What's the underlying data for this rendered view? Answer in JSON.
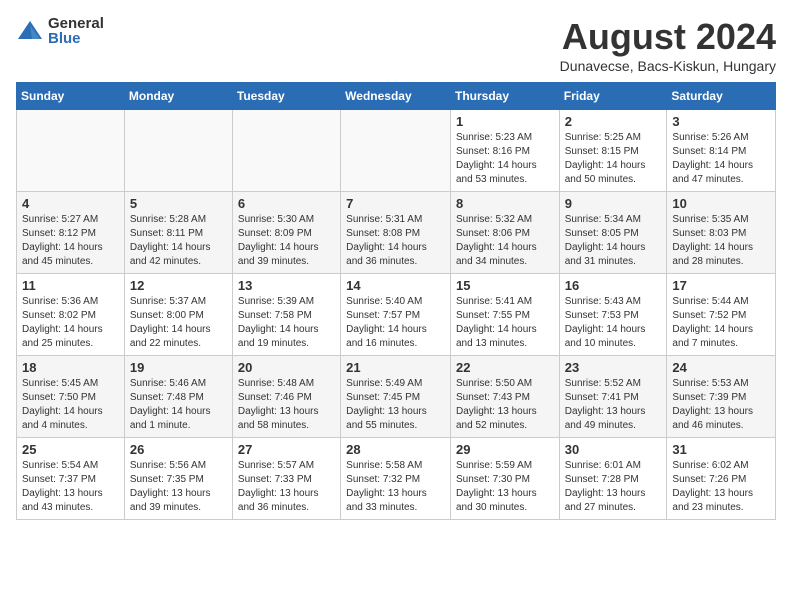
{
  "header": {
    "logo_general": "General",
    "logo_blue": "Blue",
    "title": "August 2024",
    "subtitle": "Dunavecse, Bacs-Kiskun, Hungary"
  },
  "weekdays": [
    "Sunday",
    "Monday",
    "Tuesday",
    "Wednesday",
    "Thursday",
    "Friday",
    "Saturday"
  ],
  "weeks": [
    [
      {
        "num": "",
        "info": ""
      },
      {
        "num": "",
        "info": ""
      },
      {
        "num": "",
        "info": ""
      },
      {
        "num": "",
        "info": ""
      },
      {
        "num": "1",
        "info": "Sunrise: 5:23 AM\nSunset: 8:16 PM\nDaylight: 14 hours and 53 minutes."
      },
      {
        "num": "2",
        "info": "Sunrise: 5:25 AM\nSunset: 8:15 PM\nDaylight: 14 hours and 50 minutes."
      },
      {
        "num": "3",
        "info": "Sunrise: 5:26 AM\nSunset: 8:14 PM\nDaylight: 14 hours and 47 minutes."
      }
    ],
    [
      {
        "num": "4",
        "info": "Sunrise: 5:27 AM\nSunset: 8:12 PM\nDaylight: 14 hours and 45 minutes."
      },
      {
        "num": "5",
        "info": "Sunrise: 5:28 AM\nSunset: 8:11 PM\nDaylight: 14 hours and 42 minutes."
      },
      {
        "num": "6",
        "info": "Sunrise: 5:30 AM\nSunset: 8:09 PM\nDaylight: 14 hours and 39 minutes."
      },
      {
        "num": "7",
        "info": "Sunrise: 5:31 AM\nSunset: 8:08 PM\nDaylight: 14 hours and 36 minutes."
      },
      {
        "num": "8",
        "info": "Sunrise: 5:32 AM\nSunset: 8:06 PM\nDaylight: 14 hours and 34 minutes."
      },
      {
        "num": "9",
        "info": "Sunrise: 5:34 AM\nSunset: 8:05 PM\nDaylight: 14 hours and 31 minutes."
      },
      {
        "num": "10",
        "info": "Sunrise: 5:35 AM\nSunset: 8:03 PM\nDaylight: 14 hours and 28 minutes."
      }
    ],
    [
      {
        "num": "11",
        "info": "Sunrise: 5:36 AM\nSunset: 8:02 PM\nDaylight: 14 hours and 25 minutes."
      },
      {
        "num": "12",
        "info": "Sunrise: 5:37 AM\nSunset: 8:00 PM\nDaylight: 14 hours and 22 minutes."
      },
      {
        "num": "13",
        "info": "Sunrise: 5:39 AM\nSunset: 7:58 PM\nDaylight: 14 hours and 19 minutes."
      },
      {
        "num": "14",
        "info": "Sunrise: 5:40 AM\nSunset: 7:57 PM\nDaylight: 14 hours and 16 minutes."
      },
      {
        "num": "15",
        "info": "Sunrise: 5:41 AM\nSunset: 7:55 PM\nDaylight: 14 hours and 13 minutes."
      },
      {
        "num": "16",
        "info": "Sunrise: 5:43 AM\nSunset: 7:53 PM\nDaylight: 14 hours and 10 minutes."
      },
      {
        "num": "17",
        "info": "Sunrise: 5:44 AM\nSunset: 7:52 PM\nDaylight: 14 hours and 7 minutes."
      }
    ],
    [
      {
        "num": "18",
        "info": "Sunrise: 5:45 AM\nSunset: 7:50 PM\nDaylight: 14 hours and 4 minutes."
      },
      {
        "num": "19",
        "info": "Sunrise: 5:46 AM\nSunset: 7:48 PM\nDaylight: 14 hours and 1 minute."
      },
      {
        "num": "20",
        "info": "Sunrise: 5:48 AM\nSunset: 7:46 PM\nDaylight: 13 hours and 58 minutes."
      },
      {
        "num": "21",
        "info": "Sunrise: 5:49 AM\nSunset: 7:45 PM\nDaylight: 13 hours and 55 minutes."
      },
      {
        "num": "22",
        "info": "Sunrise: 5:50 AM\nSunset: 7:43 PM\nDaylight: 13 hours and 52 minutes."
      },
      {
        "num": "23",
        "info": "Sunrise: 5:52 AM\nSunset: 7:41 PM\nDaylight: 13 hours and 49 minutes."
      },
      {
        "num": "24",
        "info": "Sunrise: 5:53 AM\nSunset: 7:39 PM\nDaylight: 13 hours and 46 minutes."
      }
    ],
    [
      {
        "num": "25",
        "info": "Sunrise: 5:54 AM\nSunset: 7:37 PM\nDaylight: 13 hours and 43 minutes."
      },
      {
        "num": "26",
        "info": "Sunrise: 5:56 AM\nSunset: 7:35 PM\nDaylight: 13 hours and 39 minutes."
      },
      {
        "num": "27",
        "info": "Sunrise: 5:57 AM\nSunset: 7:33 PM\nDaylight: 13 hours and 36 minutes."
      },
      {
        "num": "28",
        "info": "Sunrise: 5:58 AM\nSunset: 7:32 PM\nDaylight: 13 hours and 33 minutes."
      },
      {
        "num": "29",
        "info": "Sunrise: 5:59 AM\nSunset: 7:30 PM\nDaylight: 13 hours and 30 minutes."
      },
      {
        "num": "30",
        "info": "Sunrise: 6:01 AM\nSunset: 7:28 PM\nDaylight: 13 hours and 27 minutes."
      },
      {
        "num": "31",
        "info": "Sunrise: 6:02 AM\nSunset: 7:26 PM\nDaylight: 13 hours and 23 minutes."
      }
    ]
  ]
}
